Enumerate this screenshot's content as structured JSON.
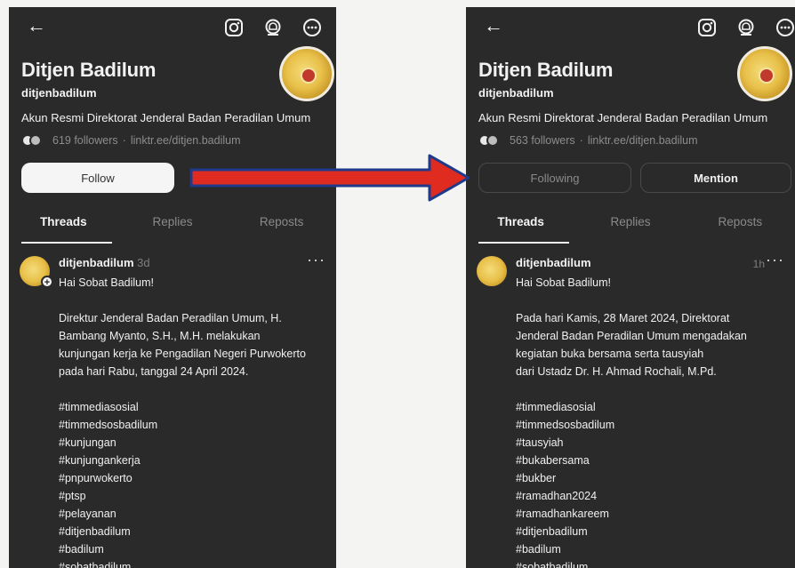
{
  "left": {
    "name": "Ditjen Badilum",
    "handle": "ditjenbadilum",
    "bio": "Akun Resmi Direktorat Jenderal Badan Peradilan Umum",
    "followers": "619 followers",
    "link": "linktr.ee/ditjen.badilum",
    "button": "Follow",
    "tabs": [
      "Threads",
      "Replies",
      "Reposts"
    ],
    "post": {
      "user": "ditjenbadilum",
      "time": "3d",
      "greeting": "Hai Sobat Badilum!",
      "body": [
        "Direktur Jenderal Badan Peradilan Umum, H.",
        "Bambang Myanto, S.H., M.H.  melakukan",
        "kunjungan kerja ke Pengadilan Negeri Purwokerto",
        "pada hari Rabu, tanggal 24 April 2024."
      ],
      "tags": [
        "#timmediasosial",
        "#timmedsosbadilum",
        "#kunjungan",
        "#kunjungankerja",
        "#pnpurwokerto",
        "#ptsp",
        "#pelayanan",
        "#ditjenbadilum",
        "#badilum",
        "#sobatbadilum"
      ]
    }
  },
  "right": {
    "name": "Ditjen Badilum",
    "handle": "ditjenbadilum",
    "bio": "Akun Resmi Direktorat Jenderal Badan Peradilan Umum",
    "followers": "563 followers",
    "link": "linktr.ee/ditjen.badilum",
    "button_following": "Following",
    "button_mention": "Mention",
    "tabs": [
      "Threads",
      "Replies",
      "Reposts"
    ],
    "post": {
      "user": "ditjenbadilum",
      "time": "1h",
      "greeting": "Hai Sobat Badilum!",
      "body": [
        "Pada hari Kamis, 28 Maret 2024, Direktorat",
        "Jenderal Badan Peradilan Umum mengadakan",
        "kegiatan buka bersama serta tausyiah",
        "dari Ustadz Dr. H. Ahmad Rochali, M.Pd."
      ],
      "tags": [
        "#timmediasosial",
        "#timmedsosbadilum",
        "#tausyiah",
        "#bukabersama",
        "#bukber",
        "#ramadhan2024",
        "#ramadhankareem",
        "#ditjenbadilum",
        "#badilum",
        "#sobatbadilum"
      ]
    }
  },
  "icons": {
    "back": "arrow-left-icon",
    "instagram": "instagram-icon",
    "notify": "bell-icon",
    "more": "more-icon"
  },
  "colors": {
    "arrow": "#e02b20",
    "arrow_outline": "#1e3a8a"
  }
}
